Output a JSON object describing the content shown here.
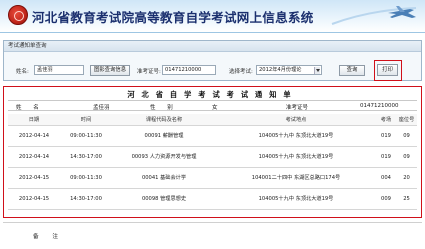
{
  "header": {
    "title": "河北省教育考试院高等教育自学考试网上信息系统"
  },
  "query": {
    "section_title": "考试通知单查询",
    "name_label": "姓名:",
    "name_value": "孟佳羽",
    "history_button": "图影查询信息",
    "ticket_label": "准考证号:",
    "ticket_value": "01471210000",
    "session_label": "选择考试:",
    "session_value": "2012年4月份理论",
    "query_button": "查询",
    "print_button": "打印"
  },
  "notice": {
    "title": "河北省自学考试考试通知单",
    "name_label": "姓 名",
    "name_value": "孟佳羽",
    "gender_label": "性 别",
    "gender_value": "女",
    "ticket_label": "准考证号",
    "ticket_value": "01471210000",
    "columns": [
      "日期",
      "时间",
      "课程代码及名称",
      "考试地点",
      "考场",
      "座位号"
    ],
    "rows": [
      [
        "2012-04-14",
        "09:00-11:30",
        "00091 薪酬管理",
        "104005十九中 东顶北大道19号",
        "019",
        "09"
      ],
      [
        "2012-04-14",
        "14:30-17:00",
        "00093 人力资源开发与管理",
        "104005十九中 东顶北大道19号",
        "019",
        "09"
      ],
      [
        "2012-04-15",
        "09:00-11:30",
        "00041 基础会计学",
        "104001二十四中 东湖区总路口174号",
        "004",
        "20"
      ],
      [
        "2012-04-15",
        "14:30-17:00",
        "00098 管理思想史",
        "104005十九中 东顶北大道19号",
        "009",
        "25"
      ]
    ]
  },
  "remarks": {
    "label": "备 注"
  }
}
